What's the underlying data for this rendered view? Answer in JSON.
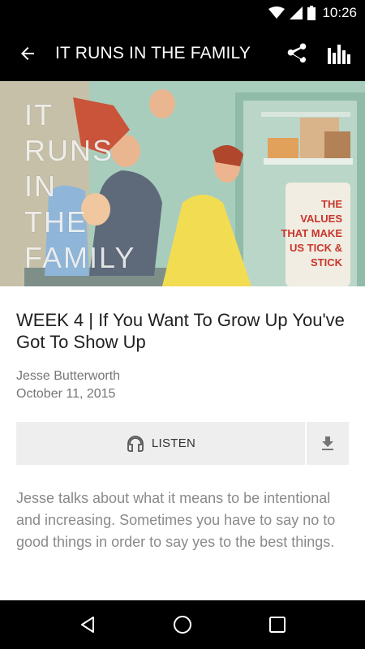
{
  "status_bar": {
    "time": "10:26"
  },
  "app_bar": {
    "title": "IT RUNS IN THE FAMILY"
  },
  "hero": {
    "title_text": "IT\nRUNS\nIN\nTHE\nFAMILY",
    "tagline": "THE\nVALUES\nTHAT MAKE\nUS TICK &\nSTICK"
  },
  "episode": {
    "title": "WEEK 4 | If You Want To Grow Up You've Got To Show Up",
    "speaker": "Jesse Butterworth",
    "date": "October 11, 2015",
    "listen_label": "LISTEN",
    "description": "Jesse talks about what it means to be intentional and increasing. Sometimes you have to say no to good things in order to say yes to the best things."
  },
  "icons": {
    "back": "arrow-back-icon",
    "share": "share-icon",
    "stats": "bar-chart-icon",
    "headphones": "headphones-icon",
    "download": "download-icon"
  },
  "colors": {
    "bar_background": "#000000",
    "button_background": "#eeeeee",
    "tagline_red": "#c9352c"
  }
}
